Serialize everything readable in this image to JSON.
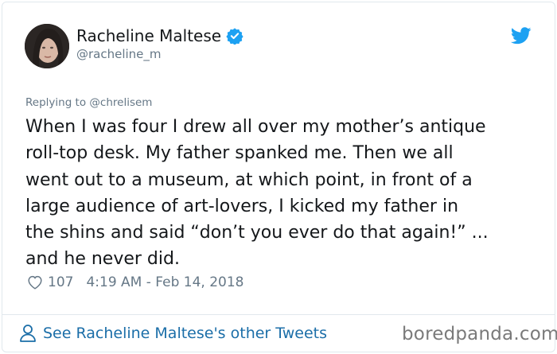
{
  "tweet": {
    "author_name": "Racheline Maltese",
    "author_handle": "@racheline_m",
    "replying_to": "Replying to @chrelisem",
    "text_lines": [
      "When I was four I drew all over my mother’s antique",
      "roll-top desk. My father spanked me. Then we all",
      "went out to a museum, at which point, in front of a",
      "large audience of art-lovers, I kicked my father in",
      "the shins and said “don’t you ever do that again!” ...",
      "and he never did."
    ],
    "likes": "107",
    "timestamp": "4:19 AM - Feb 14, 2018"
  },
  "footer": {
    "link_text": "See Racheline Maltese's other Tweets",
    "watermark": "boredpanda.com"
  },
  "icons": {
    "verified": "verified-badge-icon",
    "twitter": "twitter-bird-icon",
    "like": "heart-icon",
    "profile": "person-icon"
  },
  "colors": {
    "twitter_blue": "#1da1f2",
    "link_blue": "#1b6ea8",
    "secondary_text": "#657786",
    "border": "#e1e8ed"
  }
}
